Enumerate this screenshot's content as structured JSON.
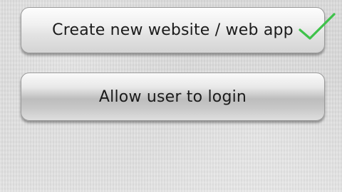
{
  "buttons": {
    "create": {
      "label": "Create new website / web app",
      "checked": true
    },
    "login": {
      "label": "Allow user to login"
    }
  },
  "colors": {
    "check": "#3ec24a",
    "text": "#1b1b1b"
  }
}
